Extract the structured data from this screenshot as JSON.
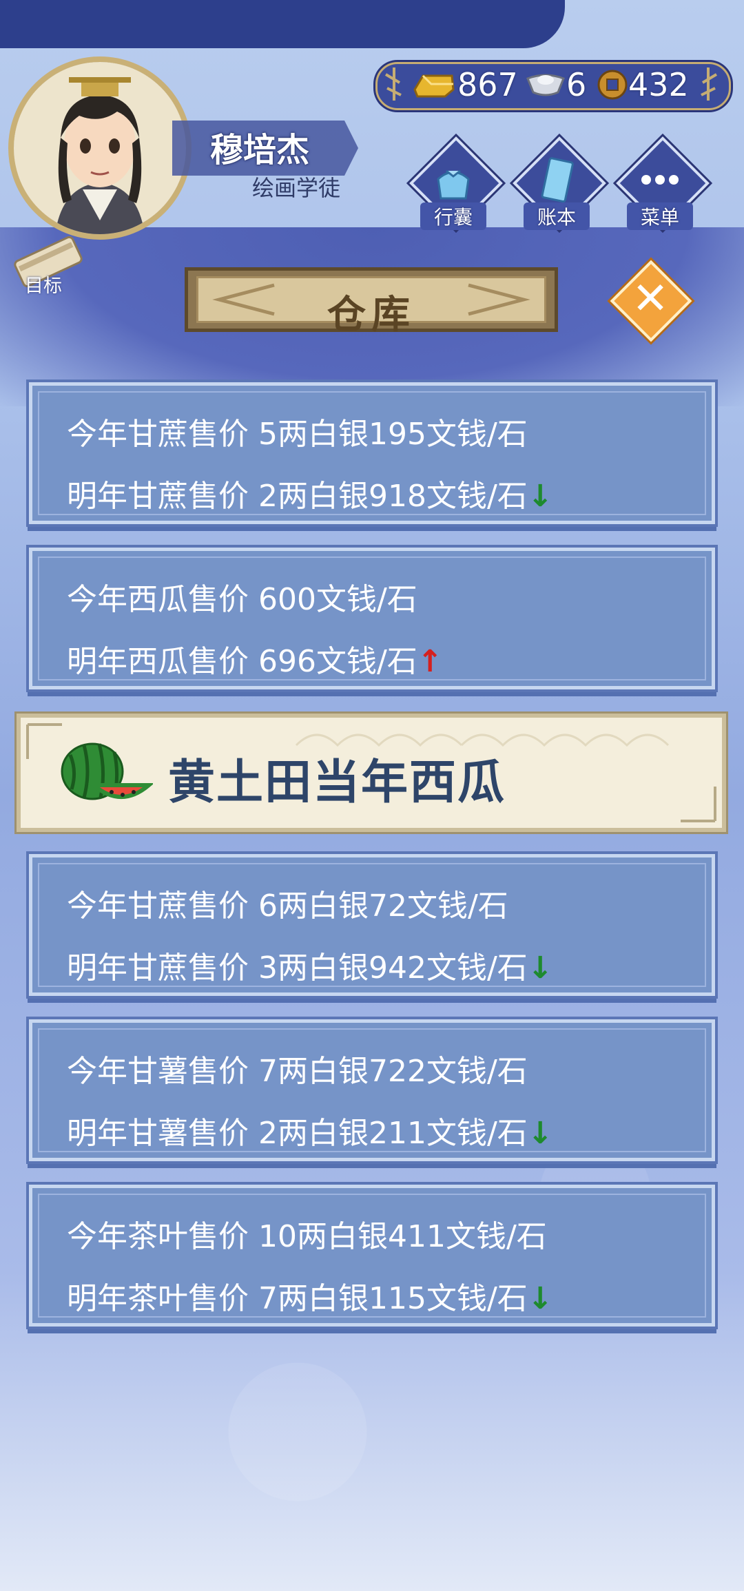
{
  "player": {
    "name": "穆培杰",
    "title": "绘画学徒",
    "goal_label": "目标"
  },
  "currency": {
    "gold": "867",
    "silver": "6",
    "coins": "432"
  },
  "menu": {
    "bag_label": "行囊",
    "ledger_label": "账本",
    "menu_label": "菜单"
  },
  "dialog": {
    "title": "仓库"
  },
  "notice": {
    "text": "黄土田当年西瓜"
  },
  "price_cards": [
    {
      "this_year": "今年甘蔗售价 5两白银195文钱/石",
      "next_year": "明年甘蔗售价 2两白银918文钱/石",
      "trend": "↓"
    },
    {
      "this_year": "今年西瓜售价 600文钱/石",
      "next_year": "明年西瓜售价 696文钱/石",
      "trend": "↑"
    },
    {
      "this_year": "今年甘蔗售价 6两白银72文钱/石",
      "next_year": "明年甘蔗售价 3两白银942文钱/石",
      "trend": "↓"
    },
    {
      "this_year": "今年甘薯售价 7两白银722文钱/石",
      "next_year": "明年甘薯售价 2两白银211文钱/石",
      "trend": "↓"
    },
    {
      "this_year": "今年茶叶售价 10两白银411文钱/石",
      "next_year": "明年茶叶售价 7两白银115文钱/石",
      "trend": "↓"
    }
  ],
  "colors": {
    "trend_down": "#1e8a2e",
    "trend_up": "#d5201e",
    "card_bg": "#7694c8",
    "accent_orange": "#f3a33c"
  }
}
